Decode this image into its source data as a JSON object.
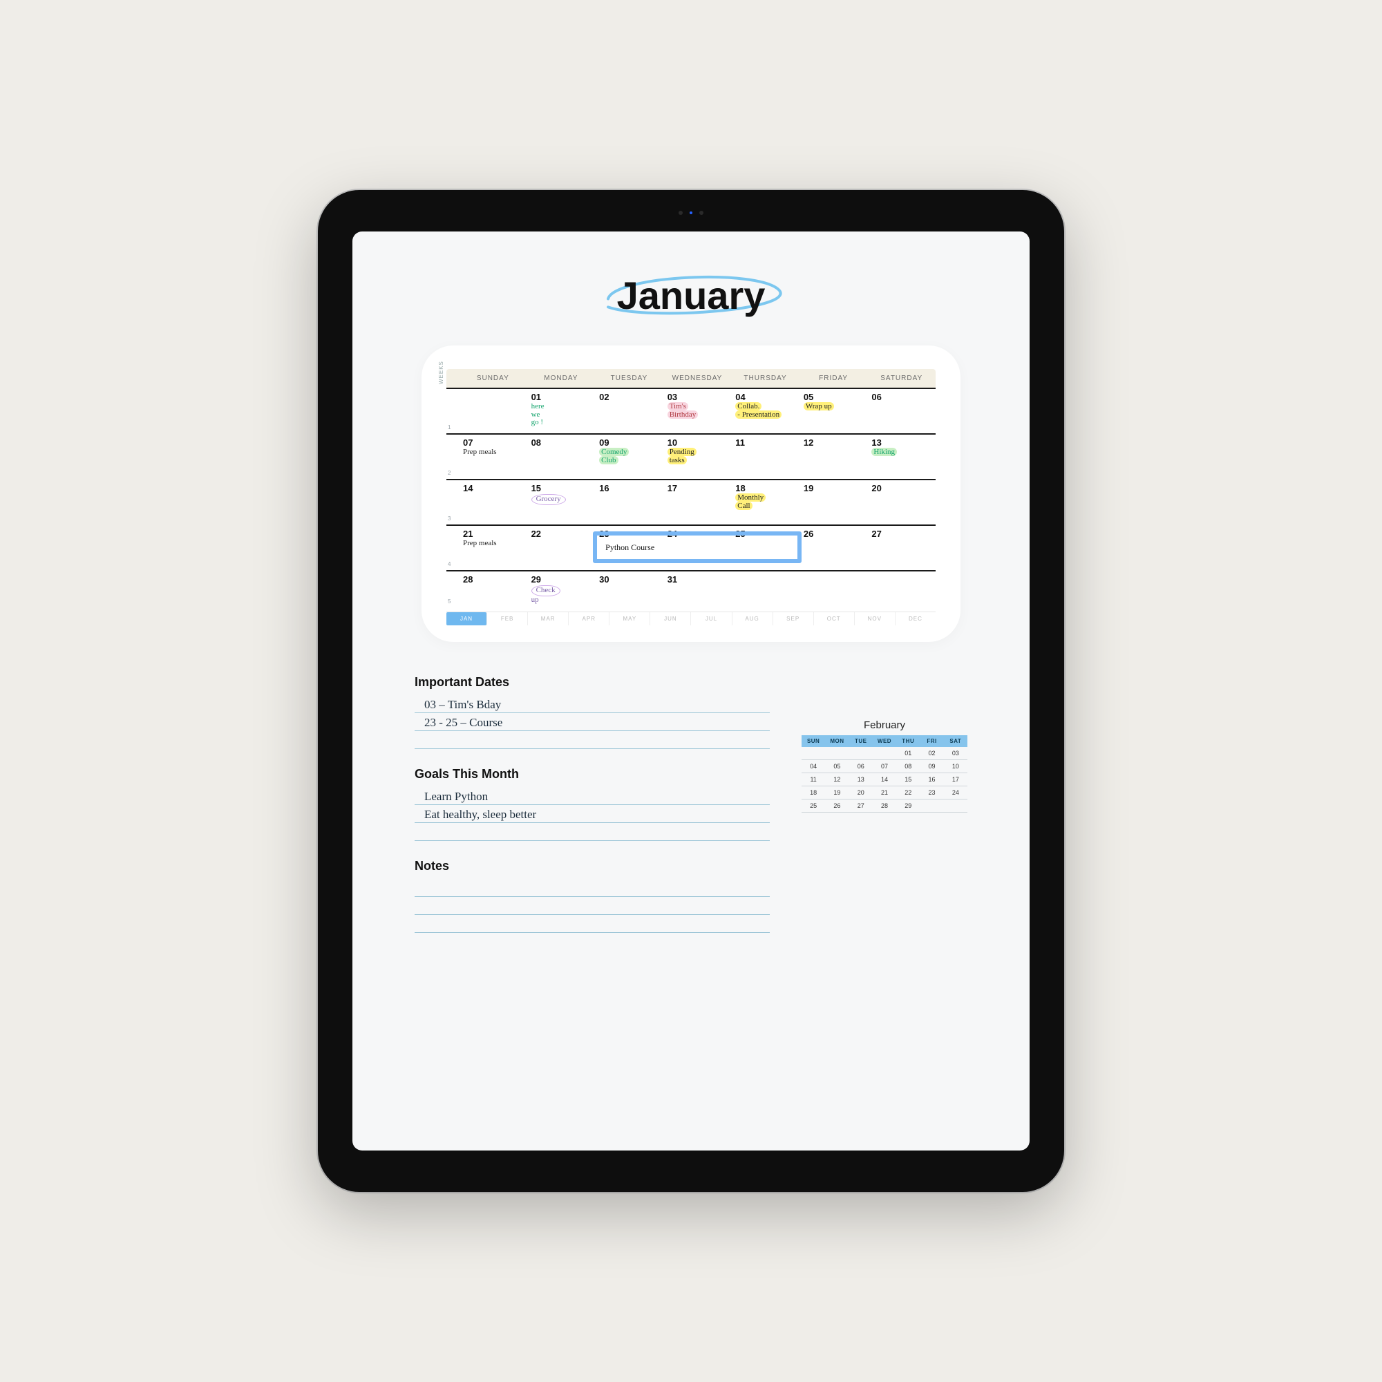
{
  "title": "January",
  "weeks_label": "WEEKS",
  "day_headers": [
    "SUNDAY",
    "MONDAY",
    "TUESDAY",
    "WEDNESDAY",
    "THURSDAY",
    "FRIDAY",
    "SATURDAY"
  ],
  "rows": [
    {
      "wk": "1",
      "cells": [
        {
          "d": ""
        },
        {
          "d": "01",
          "note": "here\nwe\ngo !",
          "cls": "green"
        },
        {
          "d": "02"
        },
        {
          "d": "03",
          "note": "Tim's\nBirthday",
          "cls": "red",
          "hl": "pink"
        },
        {
          "d": "04",
          "note": "Collab.\n- Presentation",
          "cls": "black",
          "hl": "yellow"
        },
        {
          "d": "05",
          "note": "Wrap up",
          "cls": "black",
          "hl": "yellow"
        },
        {
          "d": "06"
        }
      ]
    },
    {
      "wk": "2",
      "cells": [
        {
          "d": "07",
          "note": "Prep meals",
          "cls": "black"
        },
        {
          "d": "08"
        },
        {
          "d": "09",
          "note": "Comedy\nClub",
          "cls": "green",
          "hl": "green"
        },
        {
          "d": "10",
          "note": "Pending\ntasks",
          "cls": "black",
          "hl": "yellow"
        },
        {
          "d": "11"
        },
        {
          "d": "12"
        },
        {
          "d": "13",
          "note": "Hiking",
          "cls": "green",
          "hl": "green"
        }
      ]
    },
    {
      "wk": "3",
      "cells": [
        {
          "d": "14"
        },
        {
          "d": "15",
          "note": "Grocery",
          "cls": "purple",
          "circ": true
        },
        {
          "d": "16"
        },
        {
          "d": "17"
        },
        {
          "d": "18",
          "note": "Monthly\nCall",
          "cls": "black",
          "hl": "yellow"
        },
        {
          "d": "19"
        },
        {
          "d": "20"
        }
      ]
    },
    {
      "wk": "4",
      "cells": [
        {
          "d": "21",
          "note": "Prep meals",
          "cls": "black"
        },
        {
          "d": "22"
        },
        {
          "d": "23"
        },
        {
          "d": "24"
        },
        {
          "d": "25"
        },
        {
          "d": "26"
        },
        {
          "d": "27"
        }
      ]
    },
    {
      "wk": "5",
      "short": true,
      "cells": [
        {
          "d": "28"
        },
        {
          "d": "29",
          "note": "Check\nup",
          "cls": "purple",
          "circ": true
        },
        {
          "d": "30"
        },
        {
          "d": "31"
        },
        {
          "d": ""
        },
        {
          "d": ""
        },
        {
          "d": ""
        }
      ]
    }
  ],
  "python_span": {
    "row": 4,
    "label": "Python   Course"
  },
  "month_strip": [
    "JAN",
    "FEB",
    "MAR",
    "APR",
    "MAY",
    "JUN",
    "JUL",
    "AUG",
    "SEP",
    "OCT",
    "NOV",
    "DEC"
  ],
  "month_strip_active": 0,
  "sections": {
    "important_title": "Important Dates",
    "important_lines": [
      "03 – Tim's Bday",
      "23 - 25 – Course",
      ""
    ],
    "goals_title": "Goals This Month",
    "goals_lines": [
      "Learn Python",
      "Eat healthy, sleep better",
      ""
    ],
    "notes_title": "Notes",
    "notes_lines": [
      "",
      "",
      ""
    ]
  },
  "mini": {
    "title": "February",
    "head": [
      "SUN",
      "MON",
      "TUE",
      "WED",
      "THU",
      "FRI",
      "SAT"
    ],
    "rows": [
      [
        "",
        "",
        "",
        "",
        "01",
        "02",
        "03"
      ],
      [
        "04",
        "05",
        "06",
        "07",
        "08",
        "09",
        "10"
      ],
      [
        "11",
        "12",
        "13",
        "14",
        "15",
        "16",
        "17"
      ],
      [
        "18",
        "19",
        "20",
        "21",
        "22",
        "23",
        "24"
      ],
      [
        "25",
        "26",
        "27",
        "28",
        "29",
        "",
        ""
      ]
    ]
  }
}
